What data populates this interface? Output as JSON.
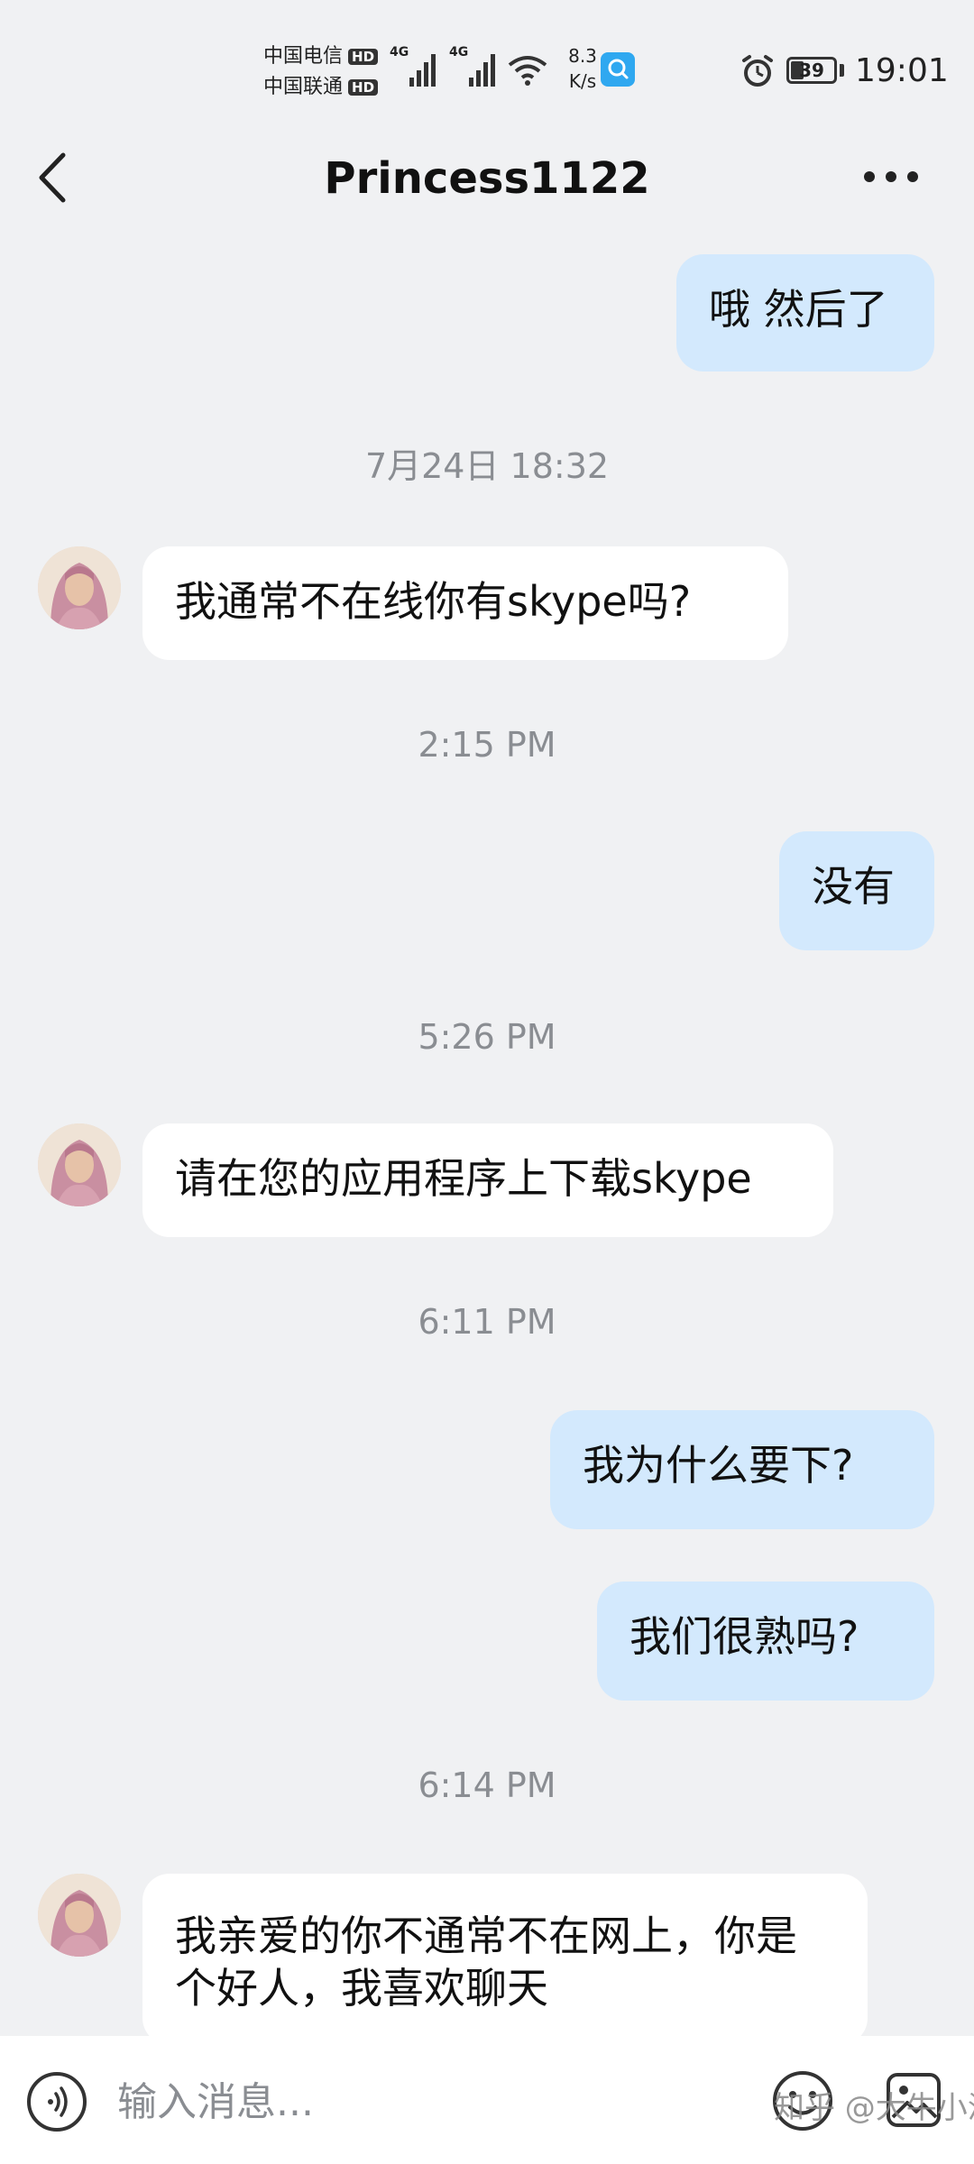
{
  "status_bar": {
    "carrier_1": "中国电信",
    "carrier_2": "中国联通",
    "hd_badge": "HD",
    "network_1": "4G",
    "network_2": "4G",
    "speed_value": "8.3",
    "speed_unit": "K/s",
    "battery": "39",
    "time": "19:01"
  },
  "header": {
    "title": "Princess1122"
  },
  "messages": [
    {
      "type": "out",
      "text": "哦 然后了"
    },
    {
      "type": "time",
      "text": "7月24日 18:32"
    },
    {
      "type": "in",
      "text": "我通常不在线你有skype吗?"
    },
    {
      "type": "time",
      "text": "2:15 PM"
    },
    {
      "type": "out",
      "text": "没有"
    },
    {
      "type": "time",
      "text": "5:26 PM"
    },
    {
      "type": "in",
      "text": "请在您的应用程序上下载skype"
    },
    {
      "type": "time",
      "text": "6:11 PM"
    },
    {
      "type": "out",
      "text": "我为什么要下?"
    },
    {
      "type": "out",
      "text": "我们很熟吗?"
    },
    {
      "type": "time",
      "text": "6:14 PM"
    },
    {
      "type": "in",
      "text": "我亲爱的你不通常不在网上，你是个好人，我喜欢聊天"
    }
  ],
  "input_bar": {
    "placeholder": "输入消息...",
    "watermark": "知乎 @大牛小溜"
  },
  "icons": {
    "back": "chevron-left-icon",
    "more": "more-horizontal-icon",
    "voice": "voice-icon",
    "emoji": "emoji-icon",
    "image": "image-icon"
  }
}
